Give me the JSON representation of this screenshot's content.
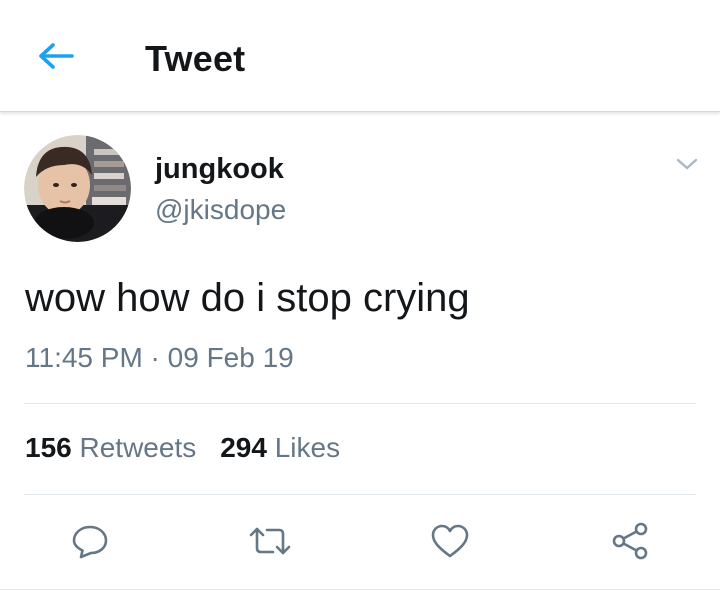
{
  "header": {
    "title": "Tweet",
    "back_icon": "arrow-left-icon"
  },
  "tweet": {
    "author": {
      "display_name": "jungkook",
      "handle": "@jkisdope",
      "avatar": "avatar-photo"
    },
    "text": "wow how do i stop crying",
    "timestamp": "11:45 PM · 09 Feb 19",
    "stats": {
      "retweets_count": "156",
      "retweets_label": "Retweets",
      "likes_count": "294",
      "likes_label": "Likes"
    },
    "actions": [
      {
        "name": "reply",
        "icon": "reply-bubble-icon"
      },
      {
        "name": "retweet",
        "icon": "retweet-arrows-icon"
      },
      {
        "name": "like",
        "icon": "heart-icon"
      },
      {
        "name": "share",
        "icon": "share-nodes-icon"
      }
    ]
  },
  "colors": {
    "accent": "#1da1f2",
    "text_primary": "#14171a",
    "text_secondary": "#657786",
    "icon_gray": "#657786",
    "divider": "#e1e8ed"
  }
}
